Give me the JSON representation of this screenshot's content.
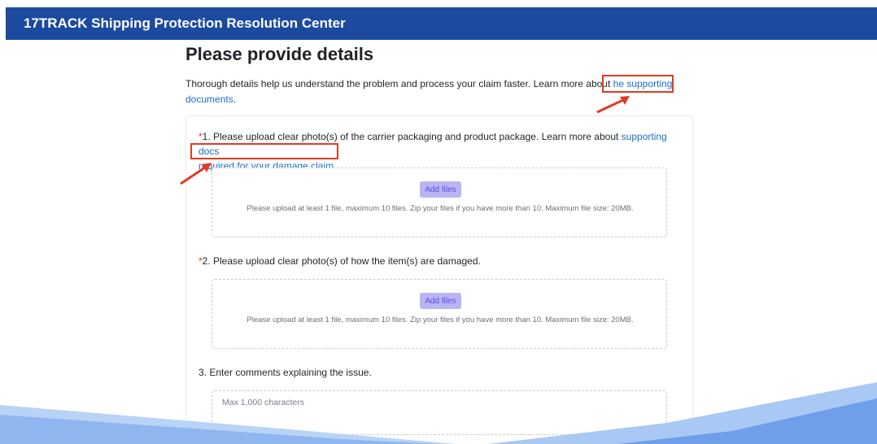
{
  "header": {
    "title": "17TRACK Shipping Protection Resolution Center"
  },
  "page": {
    "title": "Please provide details",
    "intro_text": "Thorough details help us understand the problem and process your claim faster. Learn more about ",
    "intro_link_1": "he supporting",
    "intro_link_2": "documents",
    "intro_end": "."
  },
  "questions": [
    {
      "required_mark": "*",
      "text": "1. Please upload clear photo(s) of the carrier packaging and product package. Learn more about ",
      "link_1": "supporting docs",
      "link_2": "required for your damage claim",
      "end": ".",
      "button": "Add files",
      "hint": "Please upload at least 1 file, maximum 10 files. Zip your files if you have more than 10. Maximum file size: 20MB."
    },
    {
      "required_mark": "*",
      "text": "2. Please upload clear photo(s) of how the item(s) are damaged.",
      "button": "Add files",
      "hint": "Please upload at least 1 file, maximum 10 files. Zip your files if you have more than 10. Maximum file size: 20MB."
    },
    {
      "text": "3. Enter comments explaining the issue.",
      "placeholder": "Max 1,000 characters"
    }
  ],
  "colors": {
    "header_bg": "#1c4a9e",
    "link": "#1a6fc4",
    "required": "#e03131",
    "annotation": "#e03b24",
    "button_bg": "#b9b5f5"
  }
}
